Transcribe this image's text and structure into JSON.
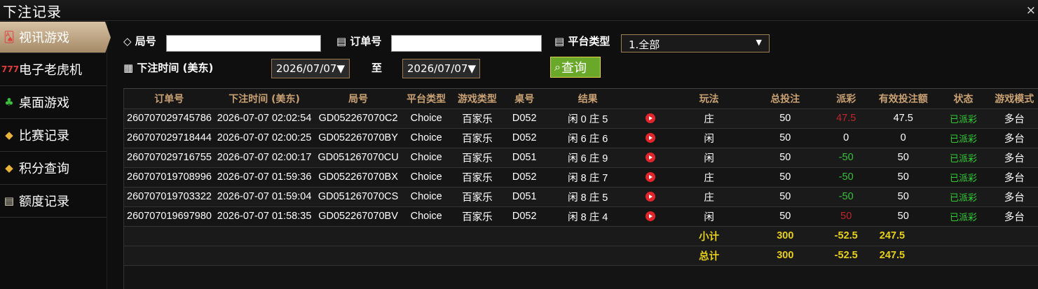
{
  "window": {
    "title": "下注记录",
    "close_glyph": "×"
  },
  "sidebar": {
    "items": [
      {
        "label": "视讯游戏",
        "icon": "video-game-icon",
        "glyph": "🂡",
        "active": true
      },
      {
        "label": "电子老虎机",
        "icon": "slot-machine-icon",
        "glyph": "777",
        "active": false
      },
      {
        "label": "桌面游戏",
        "icon": "table-game-icon",
        "glyph": "♣",
        "active": false
      },
      {
        "label": "比赛记录",
        "icon": "match-record-icon",
        "glyph": "◆",
        "active": false
      },
      {
        "label": "积分查询",
        "icon": "points-icon",
        "glyph": "◆",
        "active": false
      },
      {
        "label": "额度记录",
        "icon": "quota-record-icon",
        "glyph": "▤",
        "active": false
      }
    ]
  },
  "filters": {
    "round_label": "局号",
    "round_value": "",
    "order_label": "订单号",
    "order_value": "",
    "platform_label": "平台类型",
    "platform_selected": "1.全部",
    "time_label": "下注时间 (美东)",
    "date_from": "2026/07/07▼",
    "to_label": "至",
    "date_to": "2026/07/07▼",
    "query_label": "查询"
  },
  "table": {
    "headers": [
      "订单号",
      "下注时间 (美东)",
      "局号",
      "平台类型",
      "游戏类型",
      "桌号",
      "结果",
      "",
      "玩法",
      "总投注",
      "派彩",
      "有效投注额",
      "状态",
      "游戏模式"
    ],
    "rows": [
      [
        "260707029745786",
        "2026-07-07 02:02:54",
        "GD052267070C2",
        "Choice",
        "百家乐",
        "D052",
        "闲 0 庄 5",
        "庄",
        "50",
        "47.5",
        "47.5",
        "已派彩",
        "多台"
      ],
      [
        "260707029718444",
        "2026-07-07 02:00:25",
        "GD052267070BY",
        "Choice",
        "百家乐",
        "D052",
        "闲 6 庄 6",
        "闲",
        "50",
        "0",
        "0",
        "已派彩",
        "多台"
      ],
      [
        "260707029716755",
        "2026-07-07 02:00:17",
        "GD051267070CU",
        "Choice",
        "百家乐",
        "D051",
        "闲 6 庄 9",
        "闲",
        "50",
        "-50",
        "50",
        "已派彩",
        "多台"
      ],
      [
        "260707019708996",
        "2026-07-07 01:59:36",
        "GD052267070BX",
        "Choice",
        "百家乐",
        "D052",
        "闲 8 庄 7",
        "庄",
        "50",
        "-50",
        "50",
        "已派彩",
        "多台"
      ],
      [
        "260707019703322",
        "2026-07-07 01:59:04",
        "GD051267070CS",
        "Choice",
        "百家乐",
        "D051",
        "闲 8 庄 5",
        "庄",
        "50",
        "-50",
        "50",
        "已派彩",
        "多台"
      ],
      [
        "260707019697980",
        "2026-07-07 01:58:35",
        "GD052267070BV",
        "Choice",
        "百家乐",
        "D052",
        "闲 8 庄 4",
        "闲",
        "50",
        "50",
        "50",
        "已派彩",
        "多台"
      ]
    ],
    "payout_colors": [
      "red",
      "white",
      "green",
      "green",
      "green",
      "red"
    ],
    "subtotal": {
      "label": "小计",
      "total_bet": "300",
      "payout": "-52.5",
      "valid_bet": "247.5"
    },
    "grand_total": {
      "label": "总计",
      "total_bet": "300",
      "payout": "-52.5",
      "valid_bet": "247.5"
    }
  },
  "colors": {
    "accent": "#c9a173",
    "query_button": "#6aa82a",
    "total_text": "#e8d01b",
    "status_text": "#2fcf2f",
    "loss_red": "#c0272d"
  }
}
